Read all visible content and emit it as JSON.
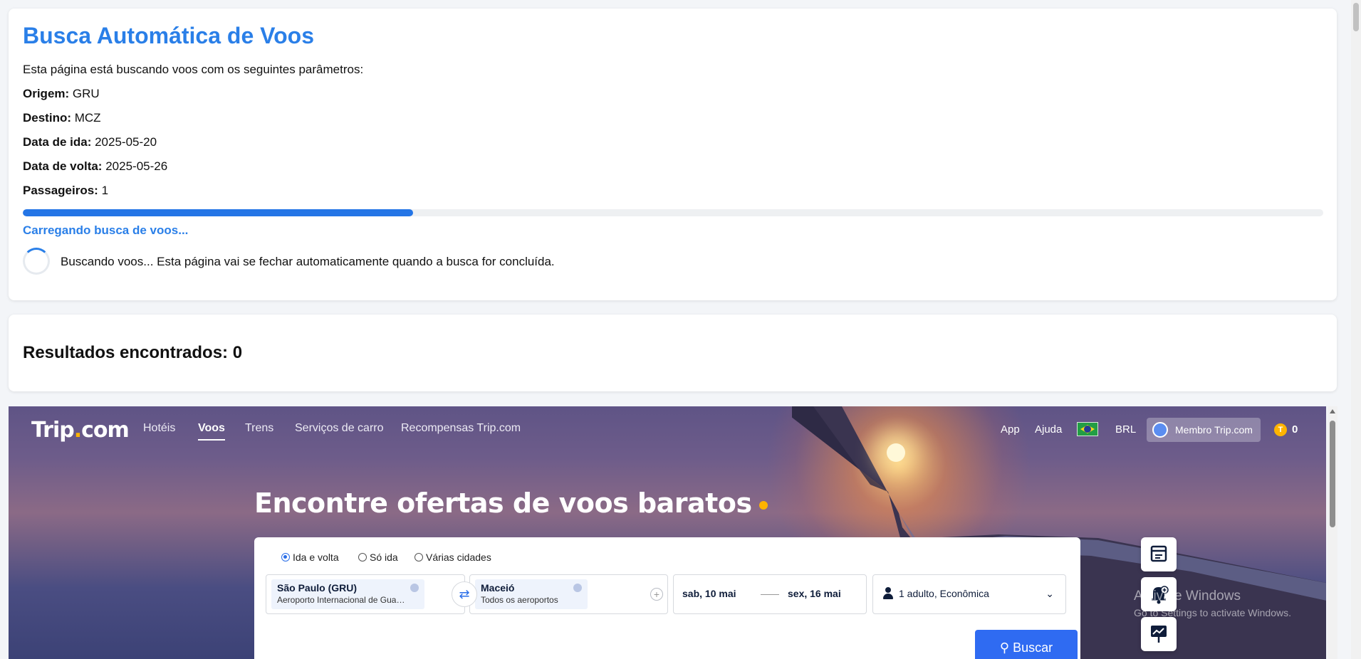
{
  "search_card": {
    "title": "Busca Automática de Voos",
    "intro": "Esta página está buscando voos com os seguintes parâmetros:",
    "params": [
      {
        "label": "Origem:",
        "value": "GRU"
      },
      {
        "label": "Destino:",
        "value": "MCZ"
      },
      {
        "label": "Data de ida:",
        "value": "2025-05-20"
      },
      {
        "label": "Data de volta:",
        "value": "2025-05-26"
      },
      {
        "label": "Passageiros:",
        "value": "1"
      }
    ],
    "progress_fraction": 0.3,
    "loading_text": "Carregando busca de voos...",
    "spinner_text": "Buscando voos... Esta página vai se fechar automaticamente quando a busca for concluída."
  },
  "results_card": {
    "text": "Resultados encontrados: 0"
  },
  "trip": {
    "logo_text": "Trip",
    "logo_dot": ".",
    "logo_suffix": "com",
    "nav": [
      "Hotéis",
      "Voos",
      "Trens",
      "Serviços de carro",
      "Recompensas Trip.com"
    ],
    "active_nav": "Voos",
    "right": {
      "app": "App",
      "help": "Ajuda",
      "currency": "BRL",
      "member": "Membro Trip.com",
      "coin_letter": "T",
      "points": "0"
    },
    "headline": "Encontre ofertas de voos baratos",
    "trip_types": [
      "Ida e volta",
      "Só ida",
      "Várias cidades"
    ],
    "selected_trip_type": "Ida e volta",
    "origin": {
      "city": "São Paulo (GRU)",
      "airport": "Aeroporto Internacional de Guar..."
    },
    "destination": {
      "city": "Maceió",
      "airport": "Todos os aeroportos"
    },
    "depart_date": "sab, 10 mai",
    "return_date": "sex, 16 mai",
    "passengers": "1 adulto, Econômica",
    "search_button": "Buscar"
  },
  "watermark": {
    "line1": "Activate Windows",
    "line2": "Go to Settings to activate Windows."
  },
  "colors": {
    "accent": "#2a7fe8",
    "progress": "#2475e6",
    "trip_button": "#2f6bf2",
    "coin": "#ffb400"
  }
}
